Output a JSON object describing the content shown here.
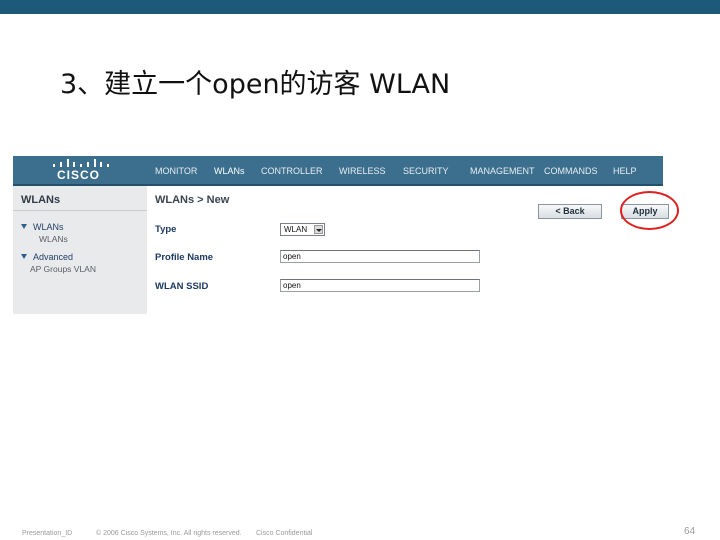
{
  "slide": {
    "title": "3、建立一个open的访客 WLAN",
    "footer_presentation": "Presentation_ID",
    "footer_copyright": "© 2006 Cisco Systems, Inc. All rights reserved.",
    "footer_confidential": "Cisco Confidential",
    "page_number": "64"
  },
  "colors": {
    "header_band": "#1d5a7a",
    "nav_bar": "#3b6f8d",
    "highlight_circle": "#e02020"
  },
  "logo": {
    "text": "CISCO"
  },
  "menu": {
    "items": [
      "MONITOR",
      "WLANs",
      "CONTROLLER",
      "WIRELESS",
      "SECURITY",
      "MANAGEMENT",
      "COMMANDS",
      "HELP"
    ],
    "active": "WLANs"
  },
  "sidebar": {
    "title": "WLANs",
    "items": [
      {
        "label": "WLANs",
        "sub": "WLANs"
      },
      {
        "label": "Advanced",
        "sub": "AP Groups VLAN"
      }
    ]
  },
  "page": {
    "breadcrumb": "WLANs > New",
    "back_label": "< Back",
    "apply_label": "Apply"
  },
  "form": {
    "type_label": "Type",
    "type_value": "WLAN",
    "profile_label": "Profile Name",
    "profile_value": "open",
    "ssid_label": "WLAN SSID",
    "ssid_value": "open"
  }
}
